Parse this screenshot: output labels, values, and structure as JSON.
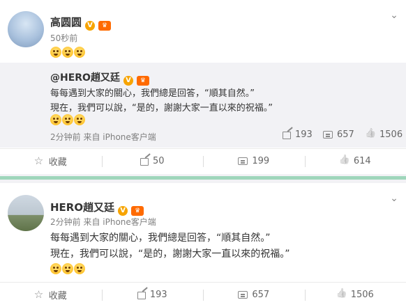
{
  "post1": {
    "author": "高圆圆",
    "time": "50秒前",
    "actions": {
      "favorite": "收藏",
      "forward": "50",
      "comment": "199",
      "like": "614"
    }
  },
  "quoted": {
    "author": "@HERO趙又廷",
    "text_line1": "每每遇到大家的關心，我們總是回答，“順其自然。”",
    "text_line2": "現在，我們可以說，“是的，謝謝大家一直以來的祝福。”",
    "meta": "2分钟前 来自 iPhone客户端",
    "forward": "193",
    "comment": "657",
    "like": "1506"
  },
  "post2": {
    "author": "HERO趙又廷",
    "meta": "2分钟前 来自 iPhone客户端",
    "text_line1": "每每遇到大家的關心，我們總是回答，“順其自然。”",
    "text_line2": "現在，我們可以說，“是的，謝謝大家一直以來的祝福。”",
    "actions": {
      "favorite": "收藏",
      "forward": "193",
      "comment": "657",
      "like": "1506"
    }
  },
  "colors": {
    "divider_green": "#9fd6bb",
    "quote_bg": "#f2f2f5",
    "vip_badge": "#f7a400",
    "crown_badge": "#ff6a00"
  },
  "icons": [
    "chevron-down-icon",
    "verified-v-icon",
    "crown-icon",
    "emoji-icon",
    "star-icon",
    "forward-icon",
    "comment-icon",
    "like-icon"
  ]
}
